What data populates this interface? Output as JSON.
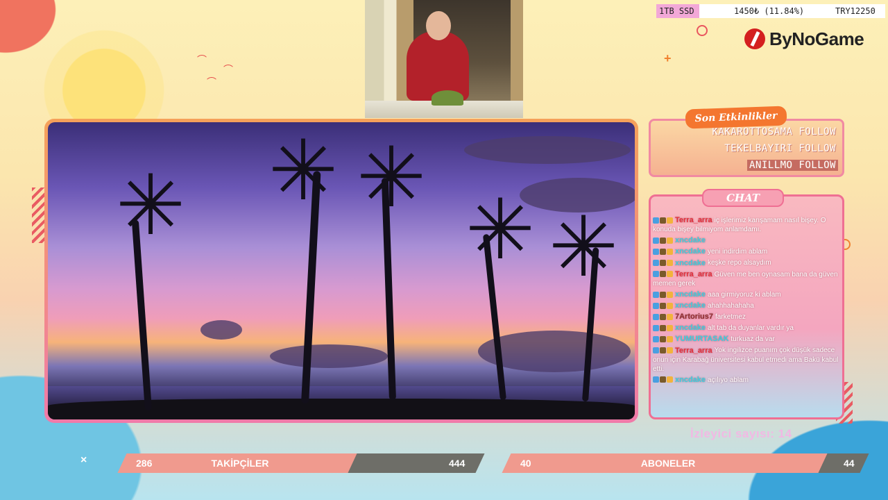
{
  "ticker": {
    "storage": "1TB SSD",
    "price": "1450₺ (11.84%)",
    "currency": "TRY12250"
  },
  "brand": {
    "logo_text": "ByNoGame",
    "accent": "#d41f1f"
  },
  "events": {
    "title": "Son Etkinlikler",
    "items": [
      "KAKAROTTOSAMA FOLLOW",
      "TEKELBAYIRI FOLLOW",
      "ANILLMO FOLLOW"
    ]
  },
  "chat": {
    "title": "CHAT",
    "messages": [
      {
        "user": "Terra_arra",
        "color": "#e5303c",
        "text": "iç işlerimiz karışamam nasıl bişey. O konuda bişey bilmiyom anlamdamı."
      },
      {
        "user": "xncdake",
        "color": "#3ad0e0",
        "text": ""
      },
      {
        "user": "xncdake",
        "color": "#3ad0e0",
        "text": "yeni indirdim ablam"
      },
      {
        "user": "xncdake",
        "color": "#3ad0e0",
        "text": "keşke repo alsaydım"
      },
      {
        "user": "Terra_arra",
        "color": "#e5303c",
        "text": "Güven me ben oynasam bana da güven memen gerek"
      },
      {
        "user": "xncdake",
        "color": "#3ad0e0",
        "text": "aaa girmiyoruz ki ablam"
      },
      {
        "user": "xncdake",
        "color": "#3ad0e0",
        "text": "ahahhahahaha"
      },
      {
        "user": "7Artorius7",
        "color": "#8e2c2c",
        "text": "farketmez"
      },
      {
        "user": "xncdake",
        "color": "#3ad0e0",
        "text": "alt tab da duyanlar vardır ya"
      },
      {
        "user": "YUMURTASAK",
        "color": "#3ad0e0",
        "text": "turkuaz da var"
      },
      {
        "user": "Terra_arra",
        "color": "#e5303c",
        "text": "Yok ingilizce puanım çok düşük sadece onun için Karabağ üniversitesi kabul etmedi ama Bakü kabul etti."
      },
      {
        "user": "xncdake",
        "color": "#3ad0e0",
        "text": "açılıyo ablam"
      }
    ]
  },
  "viewers": {
    "label": "İzleyici sayısı: 14"
  },
  "stats": {
    "followers": {
      "current": "286",
      "label": "TAKİPÇİLER",
      "goal": "444"
    },
    "subscribers": {
      "current": "40",
      "label": "ABONELER",
      "goal": "44"
    }
  }
}
